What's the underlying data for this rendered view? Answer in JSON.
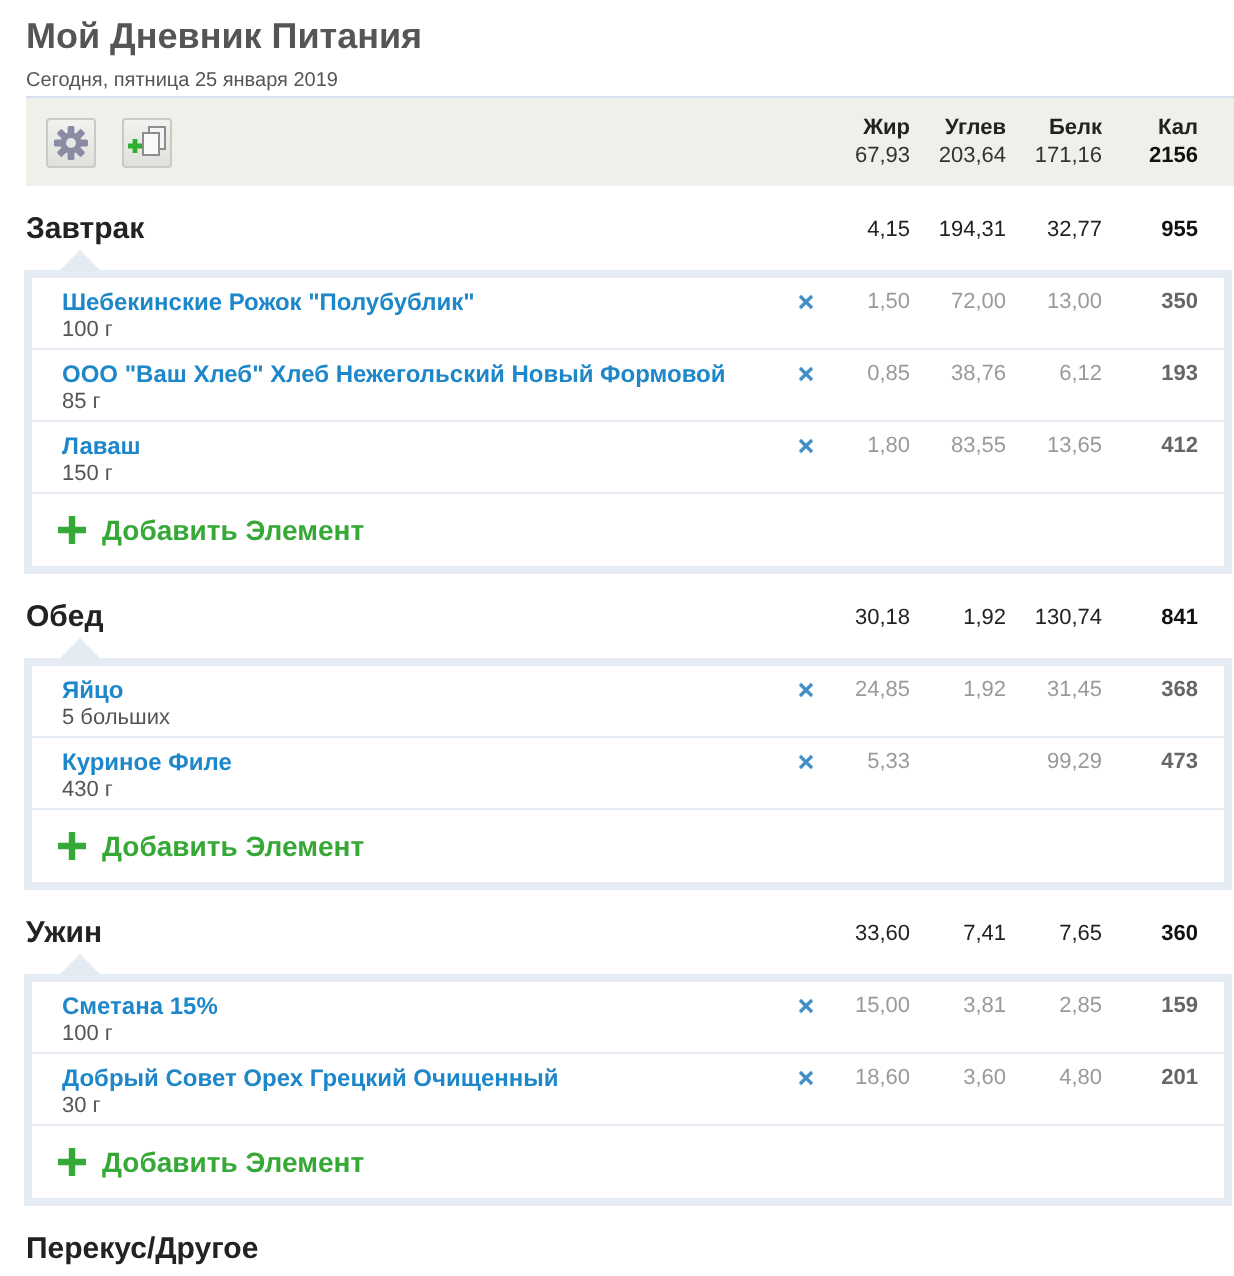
{
  "page": {
    "title": "Мой Дневник Питания",
    "date": "Сегодня, пятница 25 января 2019"
  },
  "summary": {
    "columns": [
      {
        "label": "Жир",
        "total": "67,93"
      },
      {
        "label": "Углев",
        "total": "203,64"
      },
      {
        "label": "Белк",
        "total": "171,16"
      },
      {
        "label": "Кал",
        "total": "2156"
      }
    ]
  },
  "meals": [
    {
      "name": "Завтрак",
      "totals": {
        "fat": "4,15",
        "carbs": "194,31",
        "protein": "32,77",
        "calories": "955"
      },
      "items": [
        {
          "name": "Шебекинские Рожок \"Полубублик\"",
          "portion": "100 г",
          "fat": "1,50",
          "carbs": "72,00",
          "protein": "13,00",
          "calories": "350"
        },
        {
          "name": "ООО \"Ваш Хлеб\" Хлеб Нежегольский Новый Формовой",
          "portion": "85 г",
          "fat": "0,85",
          "carbs": "38,76",
          "protein": "6,12",
          "calories": "193"
        },
        {
          "name": "Лаваш",
          "portion": "150 г",
          "fat": "1,80",
          "carbs": "83,55",
          "protein": "13,65",
          "calories": "412"
        }
      ],
      "add_label": "Добавить Элемент"
    },
    {
      "name": "Обед",
      "totals": {
        "fat": "30,18",
        "carbs": "1,92",
        "protein": "130,74",
        "calories": "841"
      },
      "items": [
        {
          "name": "Яйцо",
          "portion": "5 больших",
          "fat": "24,85",
          "carbs": "1,92",
          "protein": "31,45",
          "calories": "368"
        },
        {
          "name": "Куриное Филе",
          "portion": "430 г",
          "fat": "5,33",
          "protein": "99,29",
          "calories": "473"
        }
      ],
      "add_label": "Добавить Элемент"
    },
    {
      "name": "Ужин",
      "totals": {
        "fat": "33,60",
        "carbs": "7,41",
        "protein": "7,65",
        "calories": "360"
      },
      "items": [
        {
          "name": "Сметана 15%",
          "portion": "100 г",
          "fat": "15,00",
          "carbs": "3,81",
          "protein": "2,85",
          "calories": "159"
        },
        {
          "name": "Добрый Совет Орех Грецкий Очищенный",
          "portion": "30 г",
          "fat": "18,60",
          "carbs": "3,60",
          "protein": "4,80",
          "calories": "201"
        }
      ],
      "add_label": "Добавить Элемент"
    },
    {
      "name": "Перекус/Другое"
    }
  ]
}
